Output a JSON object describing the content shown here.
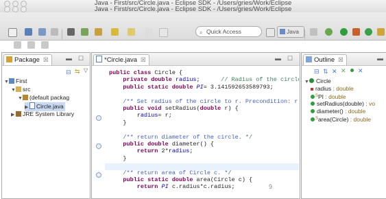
{
  "window": {
    "title_back": "Java - First/src/Circle.java - Eclipse SDK - /Users/gries/Work/Eclipse",
    "title_front": "Java - First/src/Circle.java - Eclipse SDK - /Users/gries/Work/Eclipse"
  },
  "toolbar": {
    "search_placeholder": "Quick Access",
    "perspective_label": "Java"
  },
  "package_explorer": {
    "tab_label": "Package",
    "tab_close": "☒",
    "tree": [
      {
        "label": "First",
        "indent": 0,
        "arrow": "▼",
        "icon": "project"
      },
      {
        "label": "src",
        "indent": 1,
        "arrow": "▼",
        "icon": "folder"
      },
      {
        "label": "(default packag",
        "indent": 2,
        "arrow": "▼",
        "icon": "package"
      },
      {
        "label": "Circle.java",
        "indent": 3,
        "arrow": "▶",
        "icon": "java-file",
        "selected": true
      },
      {
        "label": "JRE System Library",
        "indent": 1,
        "arrow": "▶",
        "icon": "library"
      }
    ]
  },
  "editor": {
    "tab_label": "*Circle.java",
    "tab_close": "☒",
    "page_number": "9",
    "lines": [
      [
        {
          "t": "public class ",
          "c": "kw"
        },
        {
          "t": "Circle {",
          "c": ""
        }
      ],
      [
        {
          "t": "    private double ",
          "c": "kw"
        },
        {
          "t": "radius",
          "c": "fld"
        },
        {
          "t": ";      ",
          "c": ""
        },
        {
          "t": "// Radius of the circle",
          "c": "cm"
        }
      ],
      [
        {
          "t": "    public static double ",
          "c": "kw"
        },
        {
          "t": "PI",
          "c": "fld it"
        },
        {
          "t": "= 3.141592653589793;",
          "c": ""
        }
      ],
      [
        {
          "t": "",
          "c": ""
        }
      ],
      [
        {
          "t": "    /** Set radius of the circle to r. Precondition: r",
          "c": "jd"
        }
      ],
      [
        {
          "t": "    public void ",
          "c": "kw"
        },
        {
          "t": "setRadius(",
          "c": ""
        },
        {
          "t": "double ",
          "c": "kw"
        },
        {
          "t": "r) {",
          "c": ""
        }
      ],
      [
        {
          "t": "        ",
          "c": ""
        },
        {
          "t": "radius",
          "c": "fld"
        },
        {
          "t": "= r;",
          "c": ""
        }
      ],
      [
        {
          "t": "    }",
          "c": ""
        }
      ],
      [
        {
          "t": "",
          "c": ""
        }
      ],
      [
        {
          "t": "    /** return diameter of the circle. */",
          "c": "jd"
        }
      ],
      [
        {
          "t": "    public double ",
          "c": "kw"
        },
        {
          "t": "diameter() {",
          "c": ""
        }
      ],
      [
        {
          "t": "        return ",
          "c": "kw"
        },
        {
          "t": "2*",
          "c": ""
        },
        {
          "t": "radius",
          "c": "fld"
        },
        {
          "t": ";",
          "c": ""
        }
      ],
      [
        {
          "t": "    }",
          "c": ""
        }
      ],
      [
        {
          "t": "",
          "c": ""
        }
      ],
      [
        {
          "t": "    /** return area of Circle c. */",
          "c": "jd"
        }
      ],
      [
        {
          "t": "    public static double ",
          "c": "kw"
        },
        {
          "t": "area(Circle c) {",
          "c": ""
        }
      ],
      [
        {
          "t": "        return ",
          "c": "kw"
        },
        {
          "t": "PI",
          "c": "fld it"
        },
        {
          "t": " c.radius*c.radius;",
          "c": ""
        }
      ]
    ]
  },
  "outline": {
    "tab_label": "Outline",
    "tab_close": "☒",
    "items": [
      {
        "label": "Circle",
        "suffix": "",
        "indent": 0,
        "marker": "▼",
        "icon": "class"
      },
      {
        "label": "radius",
        "suffix": " : double",
        "indent": 1,
        "icon": "private-field"
      },
      {
        "label": "PI",
        "suffix": " : double",
        "indent": 1,
        "icon": "static-field",
        "sup": "S"
      },
      {
        "label": "setRadius(double)",
        "suffix": " : vo",
        "indent": 1,
        "icon": "public-method"
      },
      {
        "label": "diameter()",
        "suffix": " : double",
        "indent": 1,
        "icon": "public-method"
      },
      {
        "label": "area(Circle)",
        "suffix": " : double",
        "indent": 1,
        "icon": "static-method",
        "sup": "S"
      }
    ]
  },
  "colors": {
    "keyword": "#7f0055",
    "field": "#0000c0",
    "comment": "#3f7f5f",
    "javadoc": "#3f5fbf",
    "selection": "#c9d9f2",
    "current_line": "#e8f2fe"
  }
}
